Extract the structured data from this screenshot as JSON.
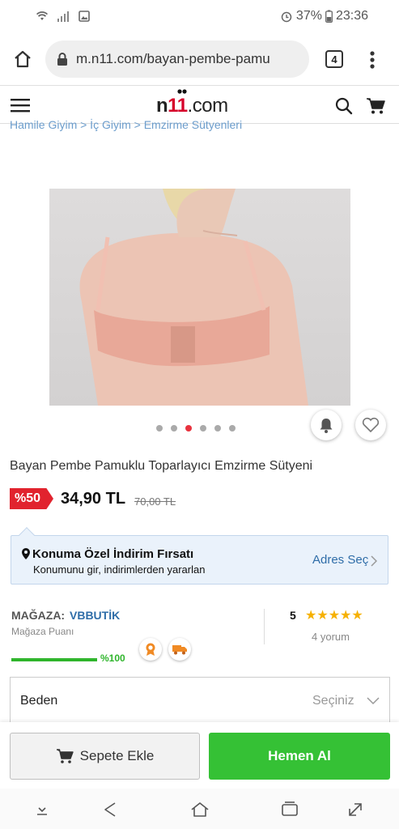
{
  "status_bar": {
    "battery": "37%",
    "time": "23:36"
  },
  "browser": {
    "url": "m.n11.com/bayan-pembe-pamu",
    "tab_count": "4"
  },
  "site": {
    "logo_prefix": "n",
    "logo_ones": "11",
    "logo_suffix": ".com"
  },
  "breadcrumb": "Hamile Giyim  >  İç Giyim  >  Emzirme Sütyenleri",
  "gallery": {
    "dot_count": 6,
    "active_dot": 2
  },
  "product": {
    "title": "Bayan Pembe Pamuklu Toparlayıcı Emzirme Sütyeni",
    "discount": "%50",
    "price": "34,90 TL",
    "old_price": "70,00 TL"
  },
  "location_offer": {
    "title": "Konuma Özel İndirim Fırsatı",
    "subtitle": "Konumunu gir, indirimlerden yararlan",
    "link": "Adres Seç"
  },
  "store": {
    "label": "MAĞAZA:",
    "name": "VBBUTİK",
    "score_label": "Mağaza Puanı",
    "score": "%100",
    "score_fraction": 1.0,
    "rating": "5",
    "stars": "★★★★★",
    "reviews": "4 yorum"
  },
  "size": {
    "label": "Beden",
    "select_placeholder": "Seçiniz"
  },
  "actions": {
    "add_to_cart": "Sepete Ekle",
    "buy_now": "Hemen Al"
  },
  "colors": {
    "brand_red": "#e1232e",
    "buy_green": "#35c135",
    "link_blue": "#2f6da8"
  }
}
